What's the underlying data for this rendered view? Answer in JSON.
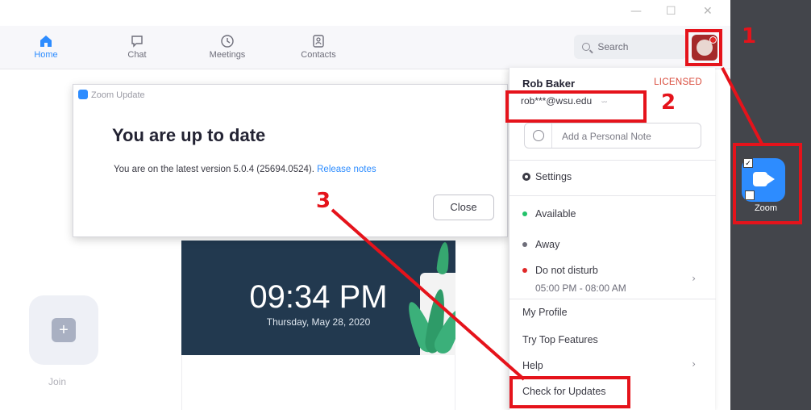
{
  "window": {
    "minimize": "—",
    "maximize": "☐",
    "close": "✕"
  },
  "nav": {
    "tabs": [
      {
        "label": "Home",
        "icon": "home-icon",
        "active": true
      },
      {
        "label": "Chat",
        "icon": "chat-icon",
        "active": false
      },
      {
        "label": "Meetings",
        "icon": "clock-icon",
        "active": false
      },
      {
        "label": "Contacts",
        "icon": "contacts-icon",
        "active": false
      }
    ],
    "search_label": "Search"
  },
  "dialog": {
    "header": "Zoom Update",
    "title": "You are up to date",
    "message": "You are on the latest version 5.0.4 (25694.0524).",
    "link": "Release notes",
    "close_label": "Close"
  },
  "main": {
    "join_label": "Join",
    "join_symbol": "+",
    "clock_time": "09:34 PM",
    "clock_date": "Thursday, May 28, 2020"
  },
  "profile": {
    "name": "Rob Baker",
    "license": "LICENSED",
    "email": "rob***@wsu.edu",
    "email_toggle_icon": "eye-hidden-icon",
    "note_placeholder": "Add a Personal Note",
    "settings": "Settings",
    "status": {
      "available": "Available",
      "away": "Away",
      "dnd": "Do not disturb",
      "dnd_time": "05:00 PM - 08:00 AM"
    },
    "menu": {
      "my_profile": "My Profile",
      "try_top_features": "Try Top Features",
      "help": "Help",
      "check_for_updates": "Check for Updates"
    }
  },
  "taskbar": {
    "app_label": "Zoom"
  },
  "annotations": {
    "n1": "1",
    "n2": "2",
    "n3": "3"
  },
  "colors": {
    "accent": "#2d8cff",
    "annotation": "#e5131b",
    "licensed": "#d94b3c"
  }
}
